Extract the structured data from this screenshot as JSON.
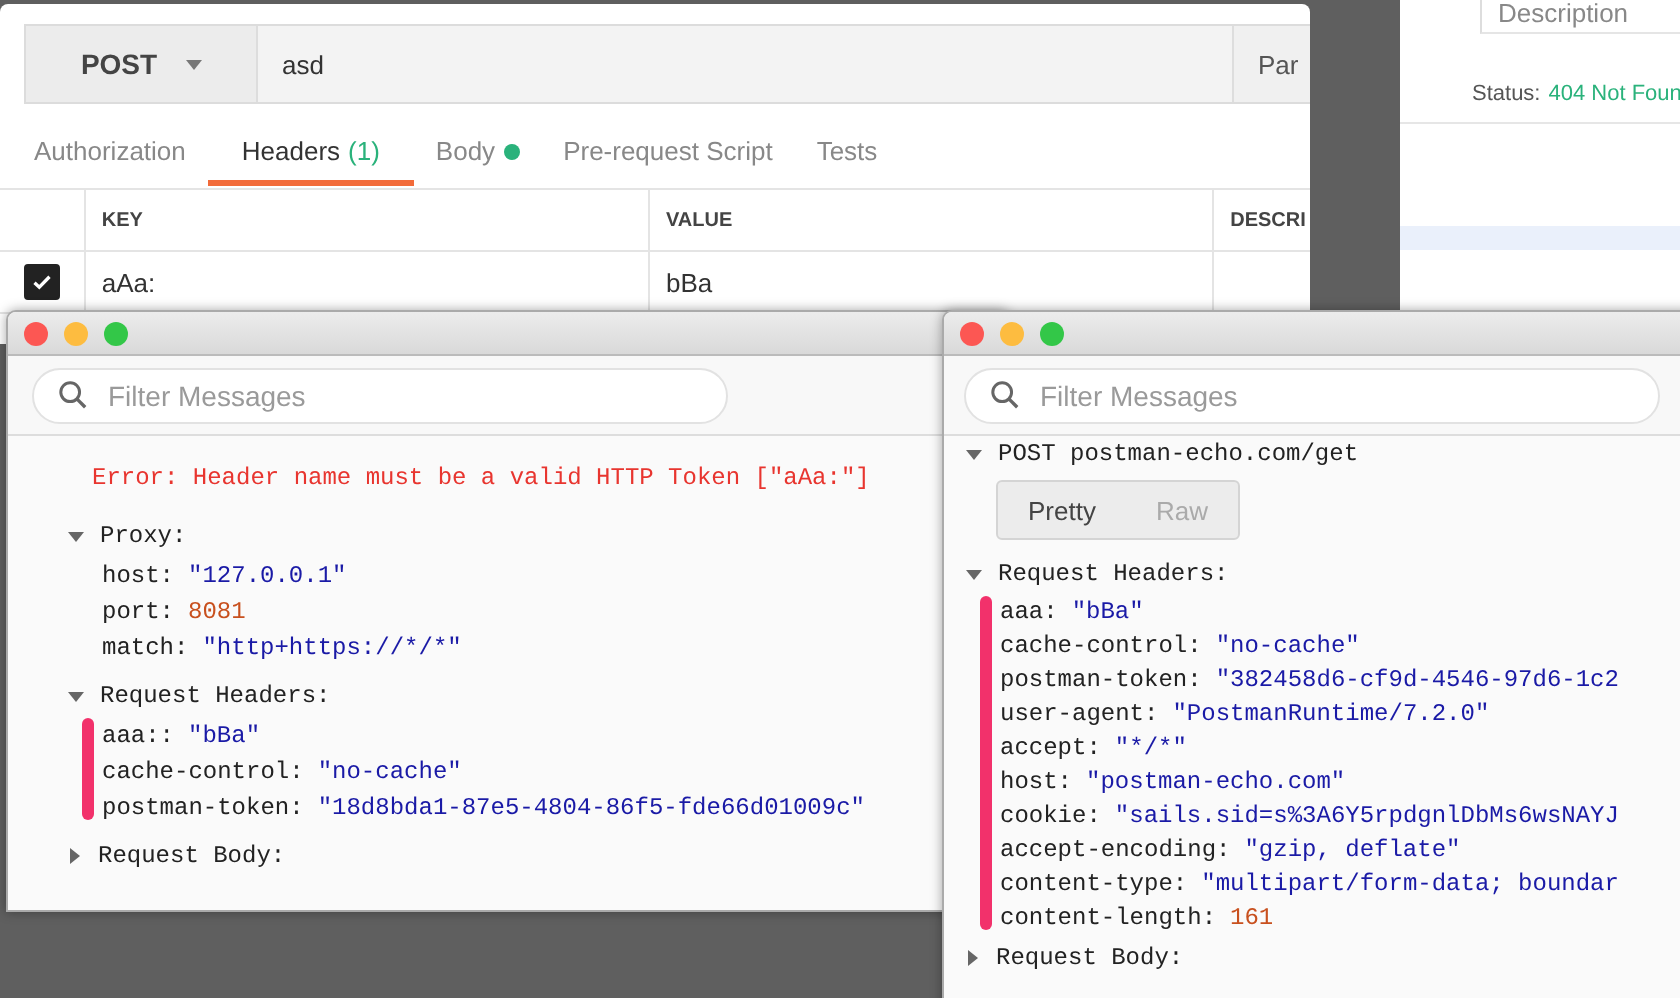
{
  "background_window": {
    "column_header": "Description",
    "status_label": "Status:",
    "status_value": "404 Not Foun"
  },
  "main_window": {
    "method": "POST",
    "url": "asd",
    "params_button": "Par",
    "tabs": [
      {
        "label": "Authorization",
        "selected": false
      },
      {
        "label": "Headers",
        "count": "(1)",
        "selected": true
      },
      {
        "label": "Body",
        "has_content": true,
        "selected": false
      },
      {
        "label": "Pre-request Script",
        "selected": false
      },
      {
        "label": "Tests",
        "selected": false
      }
    ],
    "table": {
      "columns": [
        "KEY",
        "VALUE",
        "DESCRI"
      ],
      "rows": [
        {
          "checked": true,
          "key": "aAa:",
          "value": "bBa"
        }
      ]
    }
  },
  "consoles": [
    {
      "filter_placeholder": "Filter Messages",
      "items": [
        {
          "kind": "error",
          "text": "Error: Header name must be a valid HTTP Token [\"aAa:\"]"
        },
        {
          "kind": "section",
          "title": "Proxy:",
          "expanded": true,
          "entries": [
            {
              "key": "host:",
              "value": "\"127.0.0.1\"",
              "kind": "string"
            },
            {
              "key": "port:",
              "value": "8081",
              "kind": "number"
            },
            {
              "key": "match:",
              "value": "\"http+https://*/*\"",
              "kind": "string"
            }
          ]
        },
        {
          "kind": "section",
          "title": "Request Headers:",
          "expanded": true,
          "highlighted": true,
          "entries": [
            {
              "key": "aaa::",
              "value": "\"bBa\"",
              "kind": "string"
            },
            {
              "key": "cache-control:",
              "value": "\"no-cache\"",
              "kind": "string"
            },
            {
              "key": "postman-token:",
              "value": "\"18d8bda1-87e5-4804-86f5-fde66d01009c\"",
              "kind": "string"
            }
          ]
        },
        {
          "kind": "section",
          "title": "Request Body:",
          "expanded": false
        }
      ]
    },
    {
      "filter_placeholder": "Filter Messages",
      "items": [
        {
          "kind": "request",
          "text": "POST postman-echo.com/get",
          "expanded": true
        },
        {
          "kind": "toggle",
          "options": [
            {
              "label": "Pretty",
              "selected": true
            },
            {
              "label": "Raw",
              "selected": false
            }
          ]
        },
        {
          "kind": "section",
          "title": "Request Headers:",
          "expanded": true,
          "highlighted": true,
          "entries": [
            {
              "key": "aaa:",
              "value": "\"bBa\"",
              "kind": "string"
            },
            {
              "key": "cache-control:",
              "value": "\"no-cache\"",
              "kind": "string"
            },
            {
              "key": "postman-token:",
              "value": "\"382458d6-cf9d-4546-97d6-1c2",
              "kind": "string"
            },
            {
              "key": "user-agent:",
              "value": "\"PostmanRuntime/7.2.0\"",
              "kind": "string"
            },
            {
              "key": "accept:",
              "value": "\"*/*\"",
              "kind": "string"
            },
            {
              "key": "host:",
              "value": "\"postman-echo.com\"",
              "kind": "string"
            },
            {
              "key": "cookie:",
              "value": "\"sails.sid=s%3A6Y5rpdgnlDbMs6wsNAYJ",
              "kind": "string"
            },
            {
              "key": "accept-encoding:",
              "value": "\"gzip, deflate\"",
              "kind": "string"
            },
            {
              "key": "content-type:",
              "value": "\"multipart/form-data; boundar",
              "kind": "string"
            },
            {
              "key": "content-length:",
              "value": "161",
              "kind": "number"
            }
          ]
        },
        {
          "kind": "section",
          "title": "Request Body:",
          "expanded": false
        }
      ]
    }
  ]
}
